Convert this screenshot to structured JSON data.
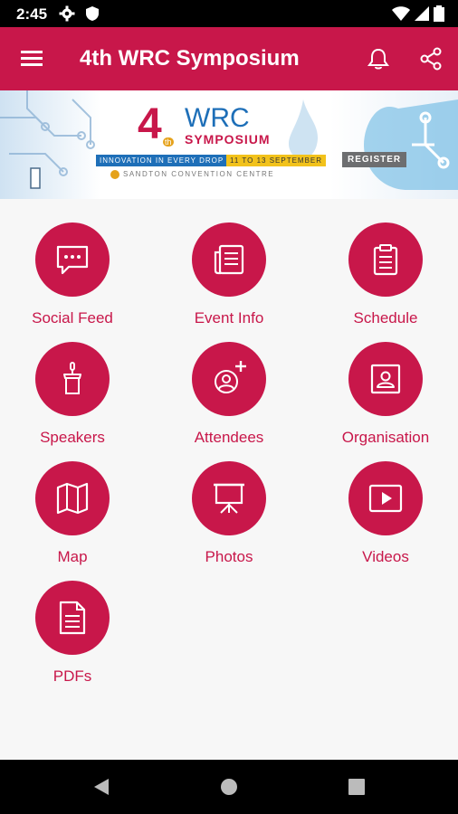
{
  "status_bar": {
    "time": "2:45"
  },
  "app_bar": {
    "title": "4th WRC Symposium"
  },
  "banner": {
    "logo_number": "4",
    "logo_superscript": "th",
    "logo_title": "WRC",
    "logo_subtitle": "SYMPOSIUM",
    "tagline": "INNOVATION IN EVERY DROP",
    "dates": "11 TO 13 SEPTEMBER",
    "venue": "SANDTON CONVENTION CENTRE",
    "register": "REGISTER"
  },
  "menu": {
    "social_feed": "Social Feed",
    "event_info": "Event Info",
    "schedule": "Schedule",
    "speakers": "Speakers",
    "attendees": "Attendees",
    "organisation": "Organisation",
    "map": "Map",
    "photos": "Photos",
    "videos": "Videos",
    "pdfs": "PDFs"
  },
  "colors": {
    "accent": "#c8174a",
    "background": "#f7f7f7"
  }
}
